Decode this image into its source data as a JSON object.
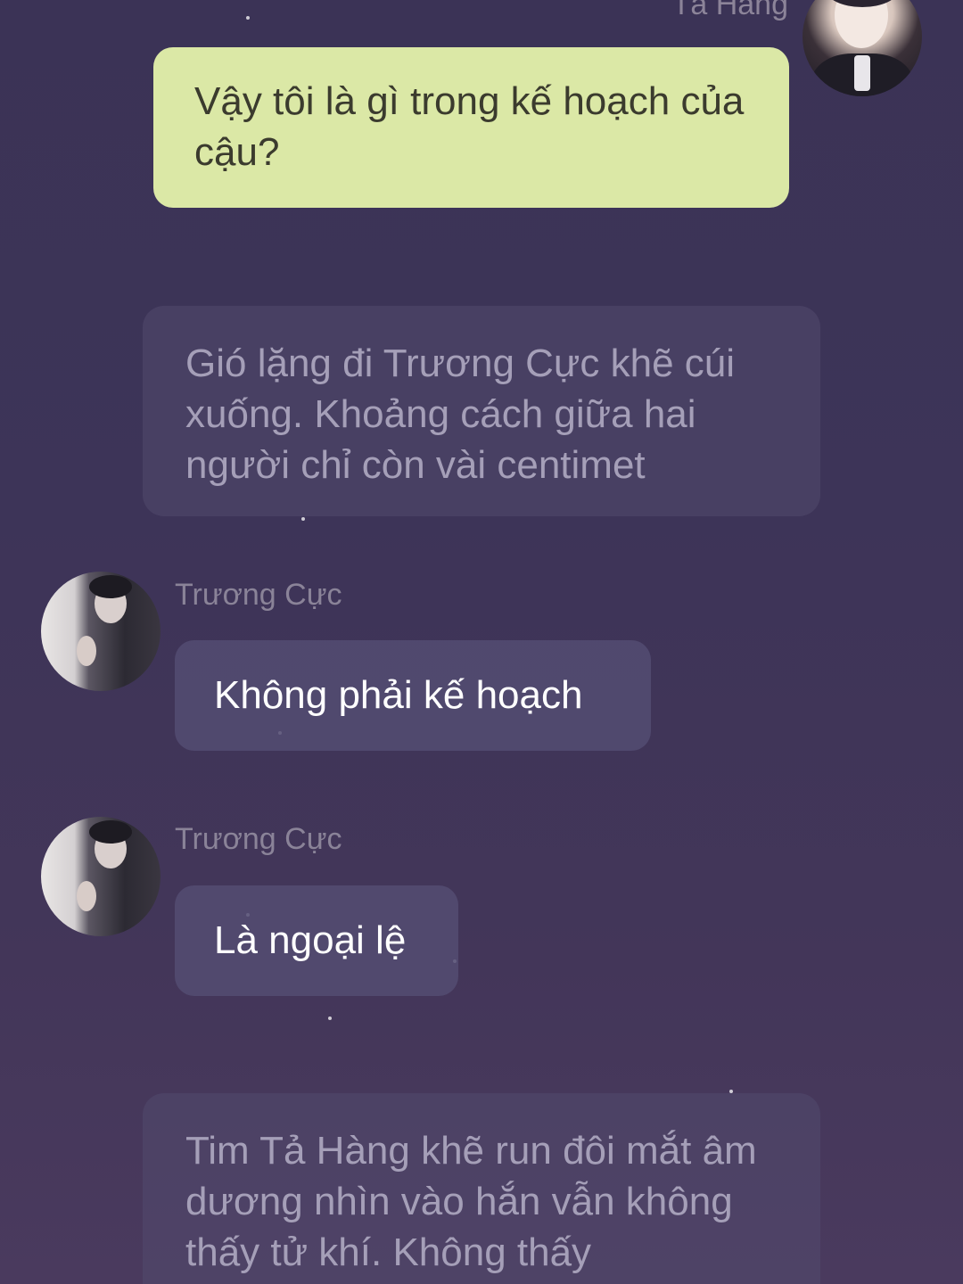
{
  "messages": [
    {
      "type": "outgoing",
      "sender": "Tả Hàng",
      "avatar": "ta-hang-avatar",
      "text": "Vậy tôi là gì trong kế hoạch của cậu?",
      "bubble_color": "#dbe8a6"
    },
    {
      "type": "narration",
      "text": "Gió lặng đi Trương Cực khẽ cúi xuống. Khoảng cách giữa hai người chỉ còn vài centimet"
    },
    {
      "type": "incoming",
      "sender": "Trương Cực",
      "avatar": "truong-cuc-avatar",
      "text": "Không phải kế hoạch"
    },
    {
      "type": "incoming",
      "sender": "Trương Cực",
      "avatar": "truong-cuc-avatar",
      "text": "Là ngoại lệ"
    },
    {
      "type": "narration",
      "text": "Tim Tả Hàng khẽ run đôi mắt âm dương nhìn vào hắn vẫn không thấy tử khí. Không thấy"
    }
  ],
  "colors": {
    "background": "#3d3458",
    "outgoing_bubble": "#dbe8a6",
    "incoming_bubble": "#544c72",
    "narration_text": "#a59fb8",
    "sender_name": "#8a8398"
  }
}
